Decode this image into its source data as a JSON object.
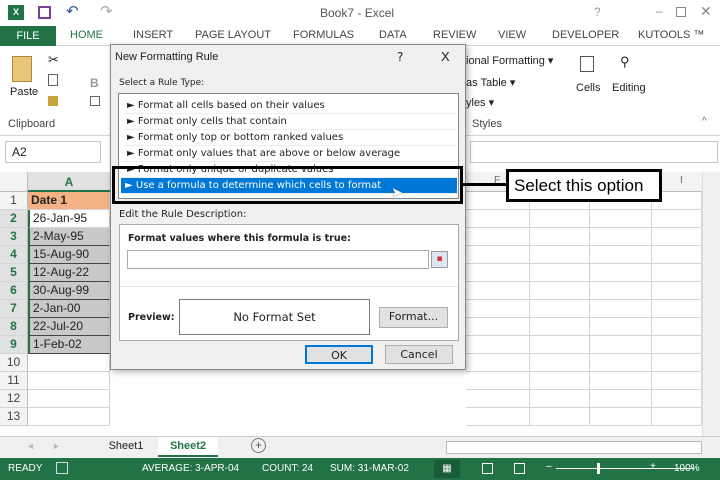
{
  "titlebar": {
    "title": "Book7 - Excel",
    "help": "?"
  },
  "tabs": [
    "FILE",
    "HOME",
    "INSERT",
    "PAGE LAYOUT",
    "FORMULAS",
    "DATA",
    "REVIEW",
    "VIEW",
    "DEVELOPER",
    "KUTOOLS ™"
  ],
  "ribbon": {
    "paste": "Paste",
    "clipboard": "Clipboard",
    "cond_format": "ional Formatting ▾",
    "format_table": "as Table ▾",
    "cell_styles": "yles ▾",
    "styles": "Styles",
    "cells": "Cells",
    "editing": "Editing",
    "bold": "B"
  },
  "formula_bar": {
    "name_box": "A2"
  },
  "grid": {
    "col_a": "A",
    "col_f": "F",
    "col_i": "I",
    "rows": [
      "1",
      "2",
      "3",
      "4",
      "5",
      "6",
      "7",
      "8",
      "9",
      "10",
      "11",
      "12",
      "13"
    ],
    "col_a_values": [
      "Date 1",
      "26-Jan-95",
      "2-May-95",
      "15-Aug-90",
      "12-Aug-22",
      "30-Aug-99",
      "2-Jan-00",
      "22-Jul-20",
      "1-Feb-02"
    ]
  },
  "dialog": {
    "title": "New Formatting Rule",
    "help": "?",
    "close": "X",
    "select_label": "Select a Rule Type:",
    "rule_types": [
      "► Format all cells based on their values",
      "► Format only cells that contain",
      "► Format only top or bottom ranked values",
      "► Format only values that are above or below average",
      "► Format only unique or duplicate values",
      "► Use a formula to determine which cells to format"
    ],
    "edit_label": "Edit the Rule Description:",
    "formula_label": "Format values where this formula is true:",
    "formula_value": "",
    "preview_label": "Preview:",
    "preview_text": "No Format Set",
    "format_button": "Format...",
    "ok": "OK",
    "cancel": "Cancel"
  },
  "callout": {
    "text": "Select this option"
  },
  "sheets": [
    "Sheet1",
    "Sheet2"
  ],
  "active_sheet": "Sheet2",
  "status": {
    "ready": "READY",
    "average": "AVERAGE: 3-APR-04",
    "count": "COUNT: 24",
    "sum": "SUM: 31-MAR-02",
    "zoom": "100%"
  },
  "colors": {
    "excel_green": "#217346",
    "header_orange": "#f4b183",
    "selected_blue": "#0078d7"
  }
}
